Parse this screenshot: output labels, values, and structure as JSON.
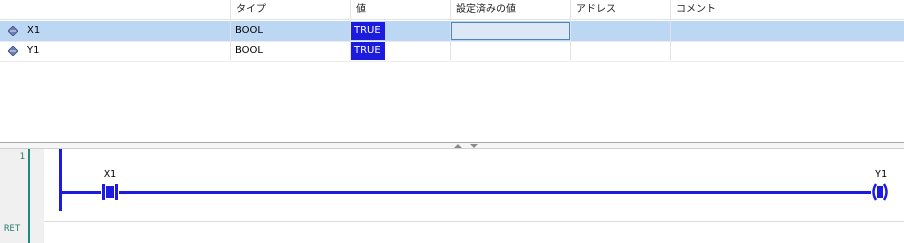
{
  "watch": {
    "columns": [
      "タイプ",
      "値",
      "設定済みの値",
      "アドレス",
      "コメント"
    ],
    "rows": [
      {
        "name": "X1",
        "type": "BOOL",
        "value": "TRUE",
        "prepared": "",
        "address": "",
        "comment": "",
        "selected": true
      },
      {
        "name": "Y1",
        "type": "BOOL",
        "value": "TRUE",
        "prepared": "",
        "address": "",
        "comment": "",
        "selected": false
      }
    ]
  },
  "ladder": {
    "network_number": "1",
    "ret_label": "RET",
    "contact": {
      "label": "X1"
    },
    "coil": {
      "label": "Y1"
    },
    "wire_color": "#1b1ce0",
    "accent_color": "#1f8a7a"
  },
  "icons": {
    "variable": "variable-icon",
    "splitter_up": "arrow-up-icon",
    "splitter_down": "arrow-down-icon"
  }
}
